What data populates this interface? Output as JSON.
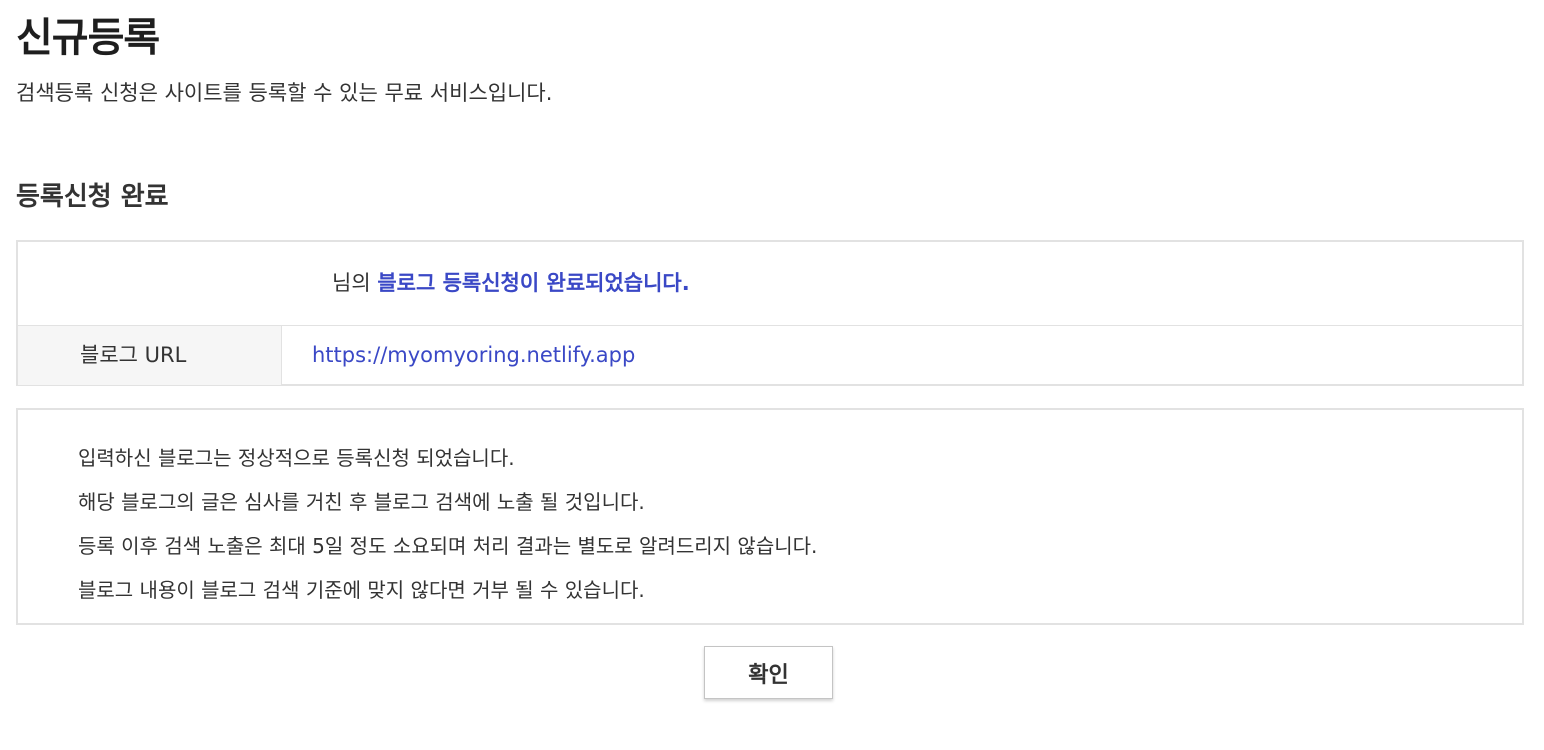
{
  "header": {
    "title": "신규등록",
    "description": "검색등록 신청은 사이트를 등록할 수 있는 무료 서비스입니다."
  },
  "section": {
    "title": "등록신청 완료"
  },
  "result": {
    "user_suffix": "님의",
    "done_message": "블로그 등록신청이 완료되었습니다.",
    "url_label": "블로그 URL",
    "url_value": "https://myomyoring.netlify.app"
  },
  "notice": {
    "lines": [
      "입력하신 블로그는 정상적으로 등록신청 되었습니다.",
      "해당 블로그의 글은 심사를 거친 후 블로그 검색에 노출 될 것입니다.",
      "등록 이후 검색 노출은 최대 5일 정도 소요되며 처리 결과는 별도로 알려드리지 않습니다.",
      "블로그 내용이 블로그 검색 기준에 맞지 않다면 거부 될 수 있습니다."
    ]
  },
  "actions": {
    "confirm_label": "확인"
  },
  "colors": {
    "accent": "#3a48c6",
    "border": "#e2e2e2",
    "label_bg": "#f6f6f6"
  }
}
